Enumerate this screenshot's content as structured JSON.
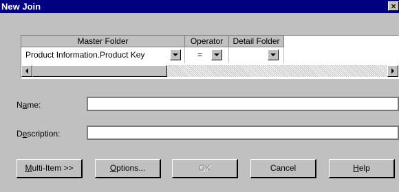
{
  "window": {
    "title": "New Join",
    "close_glyph": "×"
  },
  "grid": {
    "columns": [
      "Master Folder",
      "Operator",
      "Detail Folder"
    ],
    "rows": [
      {
        "master_folder": "Product Information.Product Key",
        "operator": "=",
        "detail_folder": ""
      }
    ]
  },
  "form": {
    "name_label": {
      "pre": "N",
      "u": "a",
      "post": "me:"
    },
    "name_value": "",
    "description_label": {
      "pre": "D",
      "u": "e",
      "post": "scription:"
    },
    "description_value": ""
  },
  "buttons": {
    "multi_item": {
      "u": "M",
      "post": "ulti-Item >>"
    },
    "options": {
      "u": "O",
      "post": "ptions..."
    },
    "ok": "OK",
    "cancel": "Cancel",
    "help": {
      "u": "H",
      "post": "elp"
    }
  },
  "icons": {
    "close": "close-icon",
    "dropdown": "chevron-down-icon",
    "scroll_left": "left-arrow-icon",
    "scroll_right": "right-arrow-icon"
  }
}
